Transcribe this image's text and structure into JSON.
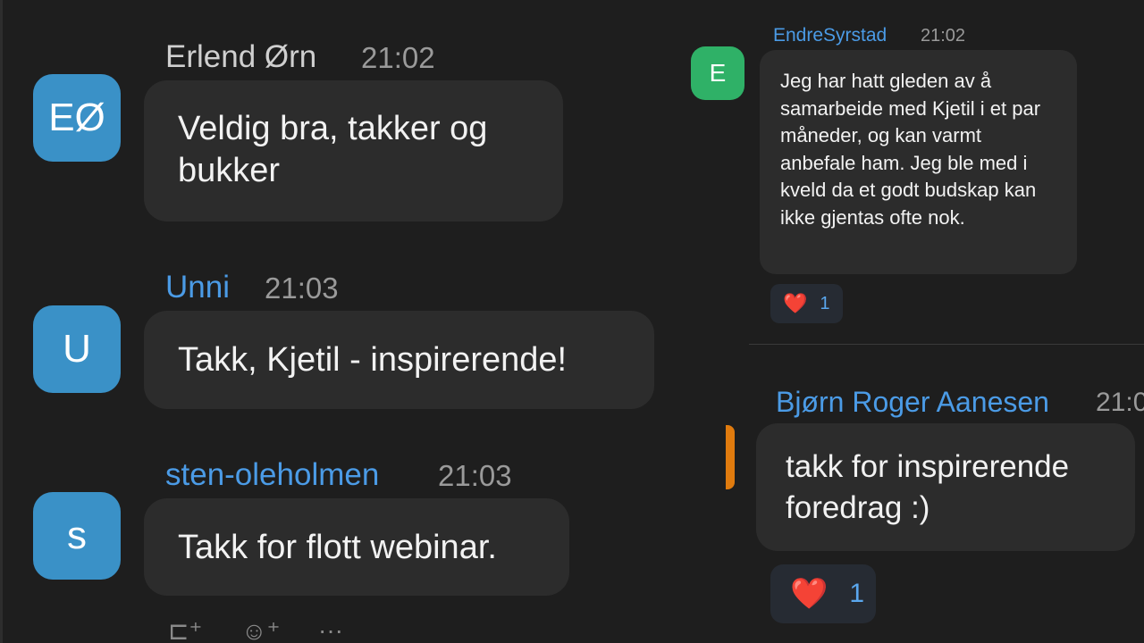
{
  "left_messages": [
    {
      "initials": "EØ",
      "name": "Erlend Ørn",
      "name_color": "#cfcfcf",
      "time": "21:02",
      "text": "Veldig bra, takker og bukker"
    },
    {
      "initials": "U",
      "name": "Unni",
      "name_color": "#4b9be6",
      "time": "21:03",
      "text": "Takk, Kjetil - inspirerende!"
    },
    {
      "initials": "s",
      "name": "sten-oleholmen",
      "name_color": "#4b9be6",
      "time": "21:03",
      "text": "Takk for flott webinar."
    }
  ],
  "right_messages": [
    {
      "initials": "E",
      "name": "EndreSyrstad",
      "time": "21:02",
      "text": "Jeg har hatt gleden av å samarbeide med Kjetil i et par måneder, og kan varmt anbefale ham. Jeg ble med i kveld da et godt budskap kan ikke gjentas ofte nok.",
      "reaction": {
        "emoji": "❤️",
        "count": "1"
      }
    },
    {
      "name": "Bjørn Roger Aanesen",
      "time": "21:0",
      "text": "takk for inspirerende foredrag :)",
      "reaction": {
        "emoji": "❤️",
        "count": "1"
      }
    }
  ],
  "toolbar": [
    {
      "icon": "add-reply-icon",
      "glyph": "⊏⁺"
    },
    {
      "icon": "add-emoji-icon",
      "glyph": "☺⁺"
    },
    {
      "icon": "more-icon",
      "glyph": "···"
    }
  ],
  "colors": {
    "background": "#1e1e1e",
    "bubble": "#2c2c2c",
    "avatar_blue": "#3a91c7",
    "avatar_green": "#2fb167",
    "link_blue": "#4b9be6",
    "accent_orange": "#e07b0e"
  }
}
